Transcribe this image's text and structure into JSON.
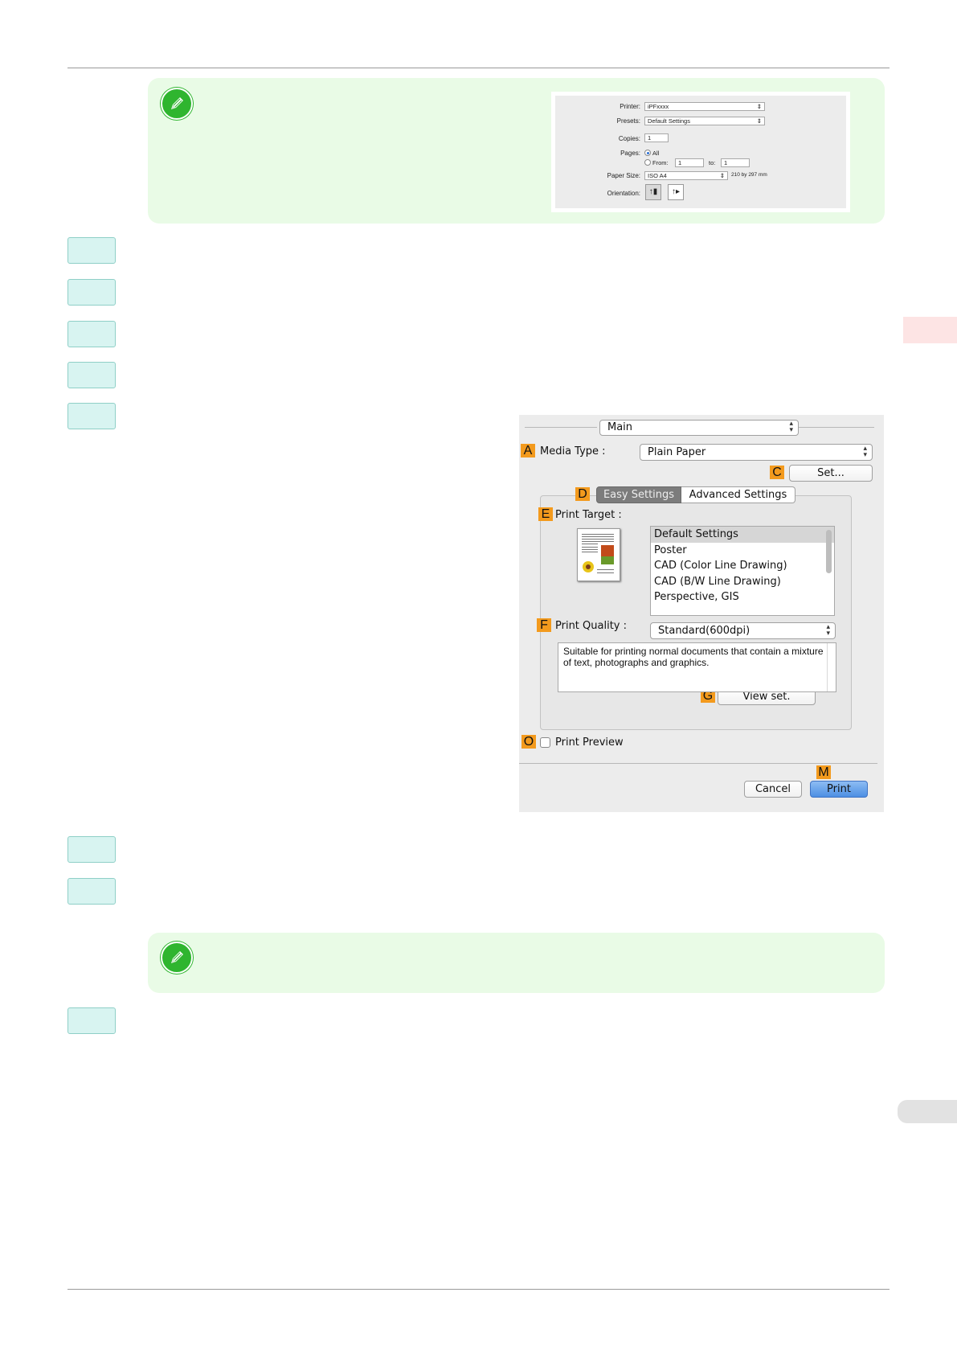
{
  "mini_dialog": {
    "printer_label": "Printer:",
    "printer_value": "iPFxxxx",
    "presets_label": "Presets:",
    "presets_value": "Default Settings",
    "copies_label": "Copies:",
    "copies_value": "1",
    "pages_label": "Pages:",
    "pages_all": "All",
    "pages_from": "From:",
    "pages_from_value": "1",
    "pages_to": "to:",
    "pages_to_value": "1",
    "paper_size_label": "Paper Size:",
    "paper_size_value": "ISO A4",
    "paper_size_dims": "210 by 297 mm",
    "orientation_label": "Orientation:"
  },
  "dialog": {
    "panel_popup": "Main",
    "media_type_badge": "A",
    "media_type_label": "Media Type :",
    "media_type_value": "Plain Paper",
    "set_badge": "C",
    "set_button": "Set...",
    "tabs_badge": "D",
    "tab_easy": "Easy Settings",
    "tab_advanced": "Advanced Settings",
    "print_target_badge": "E",
    "print_target_label": "Print Target :",
    "print_targets": [
      "Default Settings",
      "Poster",
      "CAD (Color Line Drawing)",
      "CAD (B/W Line Drawing)",
      "Perspective, GIS"
    ],
    "print_quality_badge": "F",
    "print_quality_label": "Print Quality :",
    "print_quality_value": "Standard(600dpi)",
    "description": "Suitable for printing normal documents that contain a mixture of text, photographs and graphics.",
    "view_set_badge": "G",
    "view_set_button": "View set.",
    "print_preview_badge": "O",
    "print_preview_label": "Print Preview",
    "print_badge": "M",
    "cancel_button": "Cancel",
    "print_button": "Print"
  },
  "colors": {
    "note_bg": "#e9fbe6",
    "step_bg": "#d8f4f1",
    "badge": "#f39a1d",
    "print_button": "#5b9ae8"
  }
}
